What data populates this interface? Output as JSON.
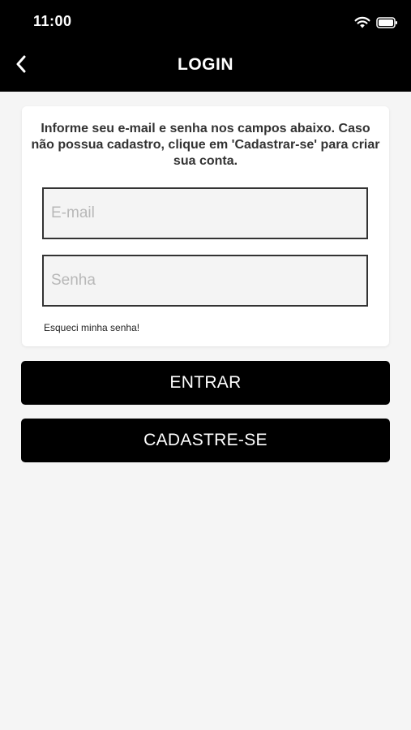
{
  "status_bar": {
    "time": "11:00",
    "icons": [
      "wifi-icon",
      "battery-icon"
    ]
  },
  "nav": {
    "title": "LOGIN",
    "back_icon": "chevron-left-icon"
  },
  "card": {
    "instructions": "Informe seu e-mail e senha nos campos abaixo. Caso não possua cadastro, clique em 'Cadastrar-se' para criar sua conta.",
    "email": {
      "placeholder": "E-mail",
      "value": ""
    },
    "password": {
      "placeholder": "Senha",
      "value": ""
    },
    "forgot_label": "Esqueci minha senha!"
  },
  "buttons": {
    "enter_label": "ENTRAR",
    "register_label": "CADASTRE-SE"
  },
  "colors": {
    "header_bg": "#000000",
    "page_bg": "#f5f5f5",
    "button_bg": "#000000",
    "button_text": "#ffffff"
  }
}
